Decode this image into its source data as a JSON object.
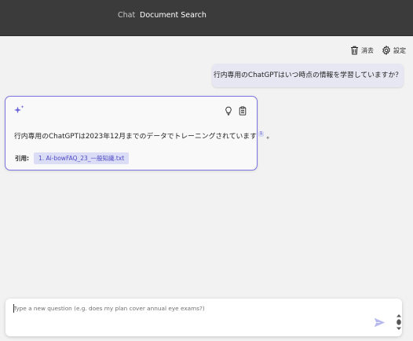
{
  "header": {
    "tabs": [
      {
        "label": "Chat"
      },
      {
        "label": "Document Search"
      }
    ]
  },
  "commands": {
    "clear_label": "消去",
    "settings_label": "設定"
  },
  "conversation": {
    "user_message": "行内専用のChatGPTはいつ時点の情報を学習していますか？",
    "answer": {
      "text": "行内専用のChatGPTは2023年12月までのデータでトレーニングされています",
      "citation_marker": "1",
      "text_end": "。",
      "citation_label": "引用:",
      "citations": [
        "1. Ai-bowFAQ_23_一般知識.txt"
      ]
    }
  },
  "input": {
    "placeholder": "Type a new question (e.g. does my plan cover annual eye exams?)"
  },
  "colors": {
    "topbar": "#3b3b3b",
    "accent": "#7b74e0",
    "citation_bg": "#dbdcf5",
    "user_bubble": "#e6e7f2",
    "send_arrow": "#b7b9ee"
  }
}
